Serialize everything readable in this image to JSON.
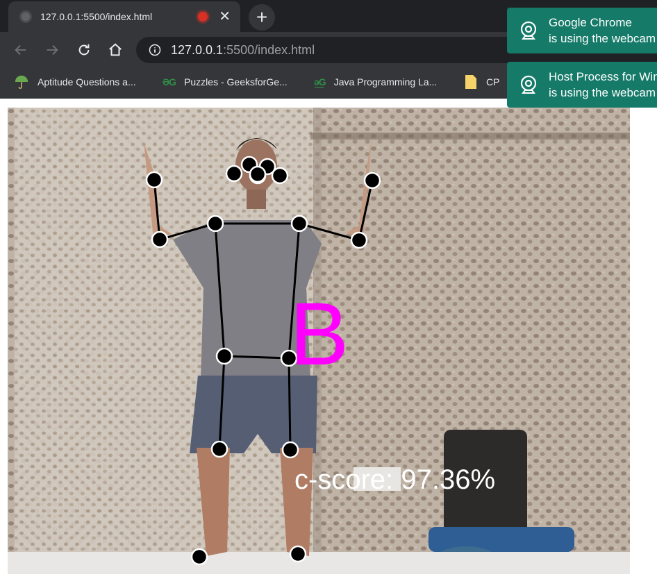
{
  "browser": {
    "tab_title": "127.0.0.1:5500/index.html",
    "url_host": "127.0.0.1",
    "url_path": ":5500/index.html",
    "bookmarks": [
      {
        "label": "Aptitude Questions a...",
        "icon": "umbrella-icon"
      },
      {
        "label": "Puzzles - GeeksforGe...",
        "icon": "geeksforgeeks-icon"
      },
      {
        "label": "Java Programming La...",
        "icon": "geeksforgeeks-icon"
      },
      {
        "label": "CP",
        "icon": "folder-icon"
      }
    ]
  },
  "notifications": [
    {
      "app": "Google Chrome",
      "message": "is using the webcam",
      "icon": "webcam-icon"
    },
    {
      "app": "Host Process for Windows Tasks",
      "message": "is using the webcam",
      "icon": "webcam-icon"
    }
  ],
  "pose_output": {
    "predicted_letter": "B",
    "confidence_text": "c-score: 97.36%"
  },
  "colors": {
    "keypoint_fill": "#000000",
    "keypoint_stroke": "#ffffff",
    "skeleton_line": "#000000",
    "letter": "#ff00ff",
    "score_text": "#ffffff",
    "notification_bg": "#157a68"
  }
}
